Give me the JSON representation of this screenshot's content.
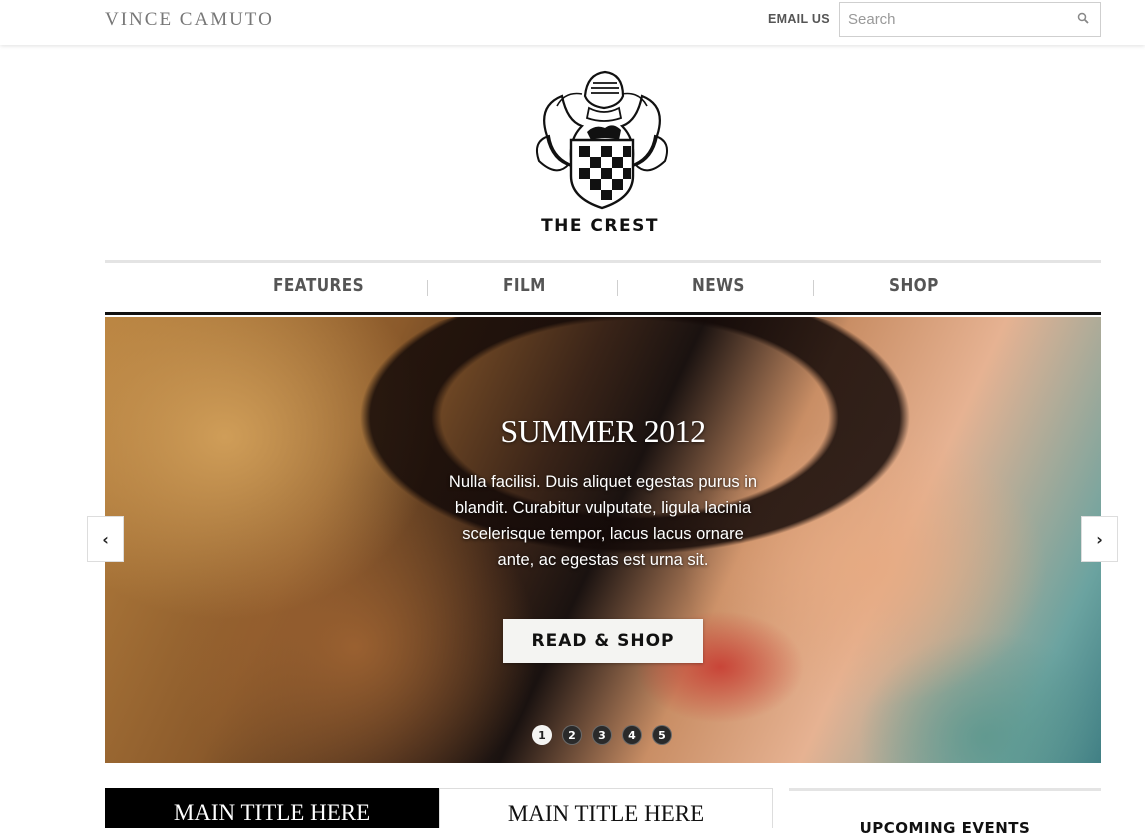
{
  "header": {
    "brand": "VINCE CAMUTO",
    "email_label": "EMAIL US",
    "search_placeholder": "Search"
  },
  "crest": {
    "title": "THE CREST"
  },
  "nav": {
    "items": [
      {
        "label": "FEATURES"
      },
      {
        "label": "FILM"
      },
      {
        "label": "NEWS"
      },
      {
        "label": "SHOP"
      }
    ]
  },
  "hero": {
    "title": "SUMMER 2012",
    "text": "Nulla facilisi. Duis aliquet egestas purus in blandit. Curabitur vulputate, ligula lacinia scelerisque tempor, lacus lacus ornare ante, ac egestas est urna sit.",
    "button_label": "READ & SHOP",
    "pager": [
      "1",
      "2",
      "3",
      "4",
      "5"
    ],
    "active_page": 1,
    "prev_label": "‹",
    "next_label": "›"
  },
  "tabs": [
    {
      "label": "MAIN TITLE HERE",
      "active": true
    },
    {
      "label": "MAIN TITLE HERE",
      "active": false
    }
  ],
  "events": {
    "title": "UPCOMING EVENTS"
  }
}
